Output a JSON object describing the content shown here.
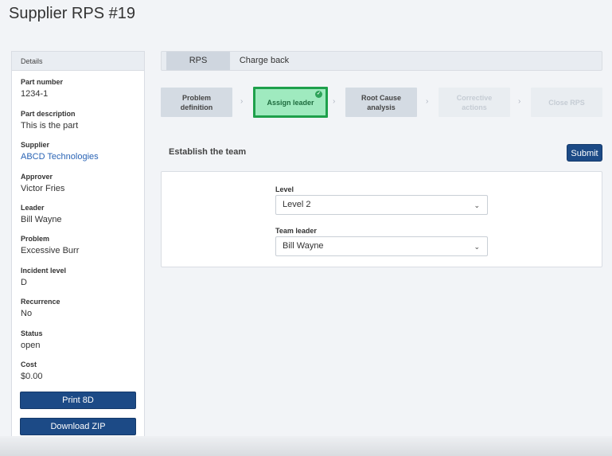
{
  "page": {
    "title": "Supplier RPS #19"
  },
  "sidebar": {
    "header": "Details",
    "fields": [
      {
        "label": "Part number",
        "value": "1234-1"
      },
      {
        "label": "Part description",
        "value": "This is the part"
      },
      {
        "label": "Supplier",
        "value": "ABCD Technologies"
      },
      {
        "label": "Approver",
        "value": "Victor Fries"
      },
      {
        "label": "Leader",
        "value": "Bill Wayne"
      },
      {
        "label": "Problem",
        "value": "Excessive Burr"
      },
      {
        "label": "Incident level",
        "value": "D"
      },
      {
        "label": "Recurrence",
        "value": "No"
      },
      {
        "label": "Status",
        "value": "open"
      },
      {
        "label": "Cost",
        "value": "$0.00"
      }
    ],
    "print_button": "Print 8D",
    "download_button": "Download ZIP"
  },
  "tabs": [
    {
      "label": "RPS",
      "active": true
    },
    {
      "label": "Charge back",
      "active": false
    }
  ],
  "steps": [
    {
      "label_line1": "Problem",
      "label_line2": "definition",
      "state": "default"
    },
    {
      "label_line1": "Assign leader",
      "label_line2": "",
      "state": "active"
    },
    {
      "label_line1": "Root Cause",
      "label_line2": "analysis",
      "state": "default"
    },
    {
      "label_line1": "Corrective",
      "label_line2": "actions",
      "state": "disabled"
    },
    {
      "label_line1": "Close RPS",
      "label_line2": "",
      "state": "disabled"
    }
  ],
  "section": {
    "title": "Establish the team",
    "submit_label": "Submit"
  },
  "form": {
    "level_label": "Level",
    "level_value": "Level 2",
    "team_leader_label": "Team leader",
    "team_leader_value": "Bill Wayne"
  },
  "icons": {
    "chevron_right": "chevron-right-icon",
    "chevron_down": "chevron-down-icon",
    "check": "check-circle-icon"
  },
  "colors": {
    "primary": "#1c4a86",
    "active_step_bg": "#9feabf",
    "active_step_border": "#1ea04b",
    "link": "#2a64b5"
  }
}
